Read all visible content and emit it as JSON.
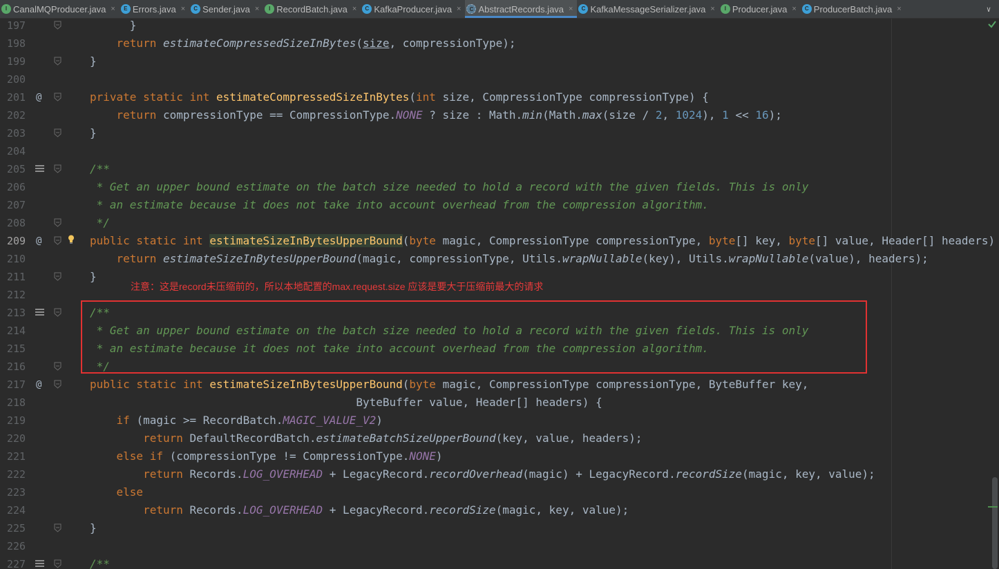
{
  "tabs": [
    {
      "label": "CanalMQProducer.java",
      "icon": "interface-icon",
      "iconLetter": "I",
      "kind": "i",
      "active": false
    },
    {
      "label": "Errors.java",
      "icon": "enum-icon",
      "iconLetter": "E",
      "kind": "e",
      "active": false
    },
    {
      "label": "Sender.java",
      "icon": "class-icon",
      "iconLetter": "C",
      "kind": "c",
      "active": false
    },
    {
      "label": "RecordBatch.java",
      "icon": "interface-icon",
      "iconLetter": "I",
      "kind": "i",
      "active": false
    },
    {
      "label": "KafkaProducer.java",
      "icon": "class-icon",
      "iconLetter": "C",
      "kind": "c",
      "active": false
    },
    {
      "label": "AbstractRecords.java",
      "icon": "abstract-class-icon",
      "iconLetter": "C",
      "kind": "ac",
      "active": true
    },
    {
      "label": "KafkaMessageSerializer.java",
      "icon": "class-icon",
      "iconLetter": "C",
      "kind": "c",
      "active": false
    },
    {
      "label": "Producer.java",
      "icon": "interface-icon",
      "iconLetter": "I",
      "kind": "i",
      "active": false
    },
    {
      "label": "ProducerBatch.java",
      "icon": "class-icon",
      "iconLetter": "C",
      "kind": "c",
      "active": false
    }
  ],
  "close_glyph": "×",
  "overflow_glyph": "∨",
  "annotation": "注意：这是record未压缩前的，所以本地配置的max.request.size 应该是要大于压缩前最大的请求",
  "colors": {
    "keyword": "#cc7832",
    "method": "#ffc66d",
    "comment": "#629755",
    "constant": "#9876aa",
    "number": "#6897bb",
    "annotation": "#e83b3b",
    "tab_accent": "#4a88c7"
  },
  "lines": [
    {
      "n": "197",
      "gutter": [
        "fold"
      ],
      "tokens": [
        [
          "      }",
          ""
        ]
      ]
    },
    {
      "n": "198",
      "gutter": [],
      "tokens": [
        [
          "    ",
          ""
        ],
        [
          "return ",
          "kw"
        ],
        [
          "estimateCompressedSizeInBytes",
          "sfn"
        ],
        [
          "(",
          ""
        ],
        [
          "size",
          "ul"
        ],
        [
          ", compressionType);",
          ""
        ]
      ]
    },
    {
      "n": "199",
      "gutter": [
        "fold"
      ],
      "tokens": [
        [
          "}",
          ""
        ]
      ]
    },
    {
      "n": "200",
      "gutter": [],
      "tokens": []
    },
    {
      "n": "201",
      "gutter": [
        "at",
        "fold"
      ],
      "tokens": [
        [
          "private static int ",
          "kw"
        ],
        [
          "estimateCompressedSizeInBytes",
          "fn"
        ],
        [
          "(",
          ""
        ],
        [
          "int ",
          "kw"
        ],
        [
          "size, CompressionType compressionType) {",
          ""
        ]
      ]
    },
    {
      "n": "202",
      "gutter": [],
      "tokens": [
        [
          "    ",
          ""
        ],
        [
          "return ",
          "kw"
        ],
        [
          "compressionType == CompressionType.",
          ""
        ],
        [
          "NONE",
          "cst"
        ],
        [
          " ? size : Math.",
          ""
        ],
        [
          "min",
          "sfn"
        ],
        [
          "(Math.",
          ""
        ],
        [
          "max",
          "sfn"
        ],
        [
          "(size / ",
          ""
        ],
        [
          "2",
          "num"
        ],
        [
          ", ",
          ""
        ],
        [
          "1024",
          "num"
        ],
        [
          "), ",
          ""
        ],
        [
          "1",
          "num"
        ],
        [
          " << ",
          ""
        ],
        [
          "16",
          "num"
        ],
        [
          ");",
          ""
        ]
      ]
    },
    {
      "n": "203",
      "gutter": [
        "fold"
      ],
      "tokens": [
        [
          "}",
          ""
        ]
      ]
    },
    {
      "n": "204",
      "gutter": [],
      "tokens": []
    },
    {
      "n": "205",
      "gutter": [
        "doc",
        "fold"
      ],
      "tokens": [
        [
          "/**",
          "doc"
        ]
      ]
    },
    {
      "n": "206",
      "gutter": [],
      "tokens": [
        [
          " * Get an upper bound estimate on the batch size needed to hold a record with the given fields. This is only",
          "doc"
        ]
      ]
    },
    {
      "n": "207",
      "gutter": [],
      "tokens": [
        [
          " * an estimate because it does not take into account overhead from the compression algorithm.",
          "doc"
        ]
      ]
    },
    {
      "n": "208",
      "gutter": [
        "fold"
      ],
      "tokens": [
        [
          " */",
          "doc"
        ]
      ]
    },
    {
      "n": "209",
      "gutter": [
        "at",
        "fold",
        "bulb"
      ],
      "cur": true,
      "tokens": [
        [
          "public static int ",
          "kw"
        ],
        [
          "|",
          "caret"
        ],
        [
          "estimateSizeInBytesUpperBound",
          "fn hl"
        ],
        [
          "(",
          ""
        ],
        [
          "byte ",
          "kw"
        ],
        [
          "magic, CompressionType compressionType, ",
          ""
        ],
        [
          "byte",
          "kw"
        ],
        [
          "[] key, ",
          ""
        ],
        [
          "byte",
          "kw"
        ],
        [
          "[] value, Header[] headers) {",
          ""
        ]
      ]
    },
    {
      "n": "210",
      "gutter": [],
      "tokens": [
        [
          "    ",
          ""
        ],
        [
          "return ",
          "kw"
        ],
        [
          "estimateSizeInBytesUpperBound",
          "sfn"
        ],
        [
          "(magic, compressionType, Utils.",
          ""
        ],
        [
          "wrapNullable",
          "sfn"
        ],
        [
          "(key), Utils.",
          ""
        ],
        [
          "wrapNullable",
          "sfn"
        ],
        [
          "(value), headers);",
          ""
        ]
      ]
    },
    {
      "n": "211",
      "gutter": [
        "fold"
      ],
      "tokens": [
        [
          "}",
          ""
        ]
      ]
    },
    {
      "n": "212",
      "gutter": [],
      "tokens": []
    },
    {
      "n": "213",
      "gutter": [
        "doc",
        "fold"
      ],
      "tokens": [
        [
          "/**",
          "doc"
        ]
      ]
    },
    {
      "n": "214",
      "gutter": [],
      "tokens": [
        [
          " * Get an upper bound estimate on the batch size needed to hold a record with the given fields. This is only",
          "doc"
        ]
      ]
    },
    {
      "n": "215",
      "gutter": [],
      "tokens": [
        [
          " * an estimate because it does not take into account overhead from the compression algorithm.",
          "doc"
        ]
      ]
    },
    {
      "n": "216",
      "gutter": [
        "fold"
      ],
      "tokens": [
        [
          " */",
          "doc"
        ]
      ]
    },
    {
      "n": "217",
      "gutter": [
        "at",
        "fold"
      ],
      "tokens": [
        [
          "public static int ",
          "kw"
        ],
        [
          "estimateSizeInBytesUpperBound",
          "fn"
        ],
        [
          "(",
          ""
        ],
        [
          "byte ",
          "kw"
        ],
        [
          "magic, CompressionType compressionType, ByteBuffer key,",
          ""
        ]
      ]
    },
    {
      "n": "218",
      "gutter": [],
      "tokens": [
        [
          "                                        ByteBuffer value, Header[] headers) {",
          ""
        ]
      ]
    },
    {
      "n": "219",
      "gutter": [],
      "tokens": [
        [
          "    ",
          ""
        ],
        [
          "if ",
          "kw"
        ],
        [
          "(magic >= RecordBatch.",
          ""
        ],
        [
          "MAGIC_VALUE_V2",
          "cst"
        ],
        [
          ")",
          ""
        ]
      ]
    },
    {
      "n": "220",
      "gutter": [],
      "tokens": [
        [
          "        ",
          ""
        ],
        [
          "return ",
          "kw"
        ],
        [
          "DefaultRecordBatch.",
          ""
        ],
        [
          "estimateBatchSizeUpperBound",
          "sfn"
        ],
        [
          "(key, value, headers);",
          ""
        ]
      ]
    },
    {
      "n": "221",
      "gutter": [],
      "tokens": [
        [
          "    ",
          ""
        ],
        [
          "else if ",
          "kw"
        ],
        [
          "(compressionType != CompressionType.",
          ""
        ],
        [
          "NONE",
          "cst"
        ],
        [
          ")",
          ""
        ]
      ]
    },
    {
      "n": "222",
      "gutter": [],
      "tokens": [
        [
          "        ",
          ""
        ],
        [
          "return ",
          "kw"
        ],
        [
          "Records.",
          ""
        ],
        [
          "LOG_OVERHEAD",
          "cst"
        ],
        [
          " + LegacyRecord.",
          ""
        ],
        [
          "recordOverhead",
          "sfn"
        ],
        [
          "(magic) + LegacyRecord.",
          ""
        ],
        [
          "recordSize",
          "sfn"
        ],
        [
          "(magic, key, value);",
          ""
        ]
      ]
    },
    {
      "n": "223",
      "gutter": [],
      "tokens": [
        [
          "    ",
          ""
        ],
        [
          "else",
          "kw"
        ]
      ]
    },
    {
      "n": "224",
      "gutter": [],
      "tokens": [
        [
          "        ",
          ""
        ],
        [
          "return ",
          "kw"
        ],
        [
          "Records.",
          ""
        ],
        [
          "LOG_OVERHEAD",
          "cst"
        ],
        [
          " + LegacyRecord.",
          ""
        ],
        [
          "recordSize",
          "sfn"
        ],
        [
          "(magic, key, value);",
          ""
        ]
      ]
    },
    {
      "n": "225",
      "gutter": [
        "fold"
      ],
      "tokens": [
        [
          "}",
          ""
        ]
      ]
    },
    {
      "n": "226",
      "gutter": [],
      "tokens": []
    },
    {
      "n": "227",
      "gutter": [
        "doc",
        "fold"
      ],
      "tokens": [
        [
          "/**",
          "doc"
        ]
      ]
    }
  ]
}
